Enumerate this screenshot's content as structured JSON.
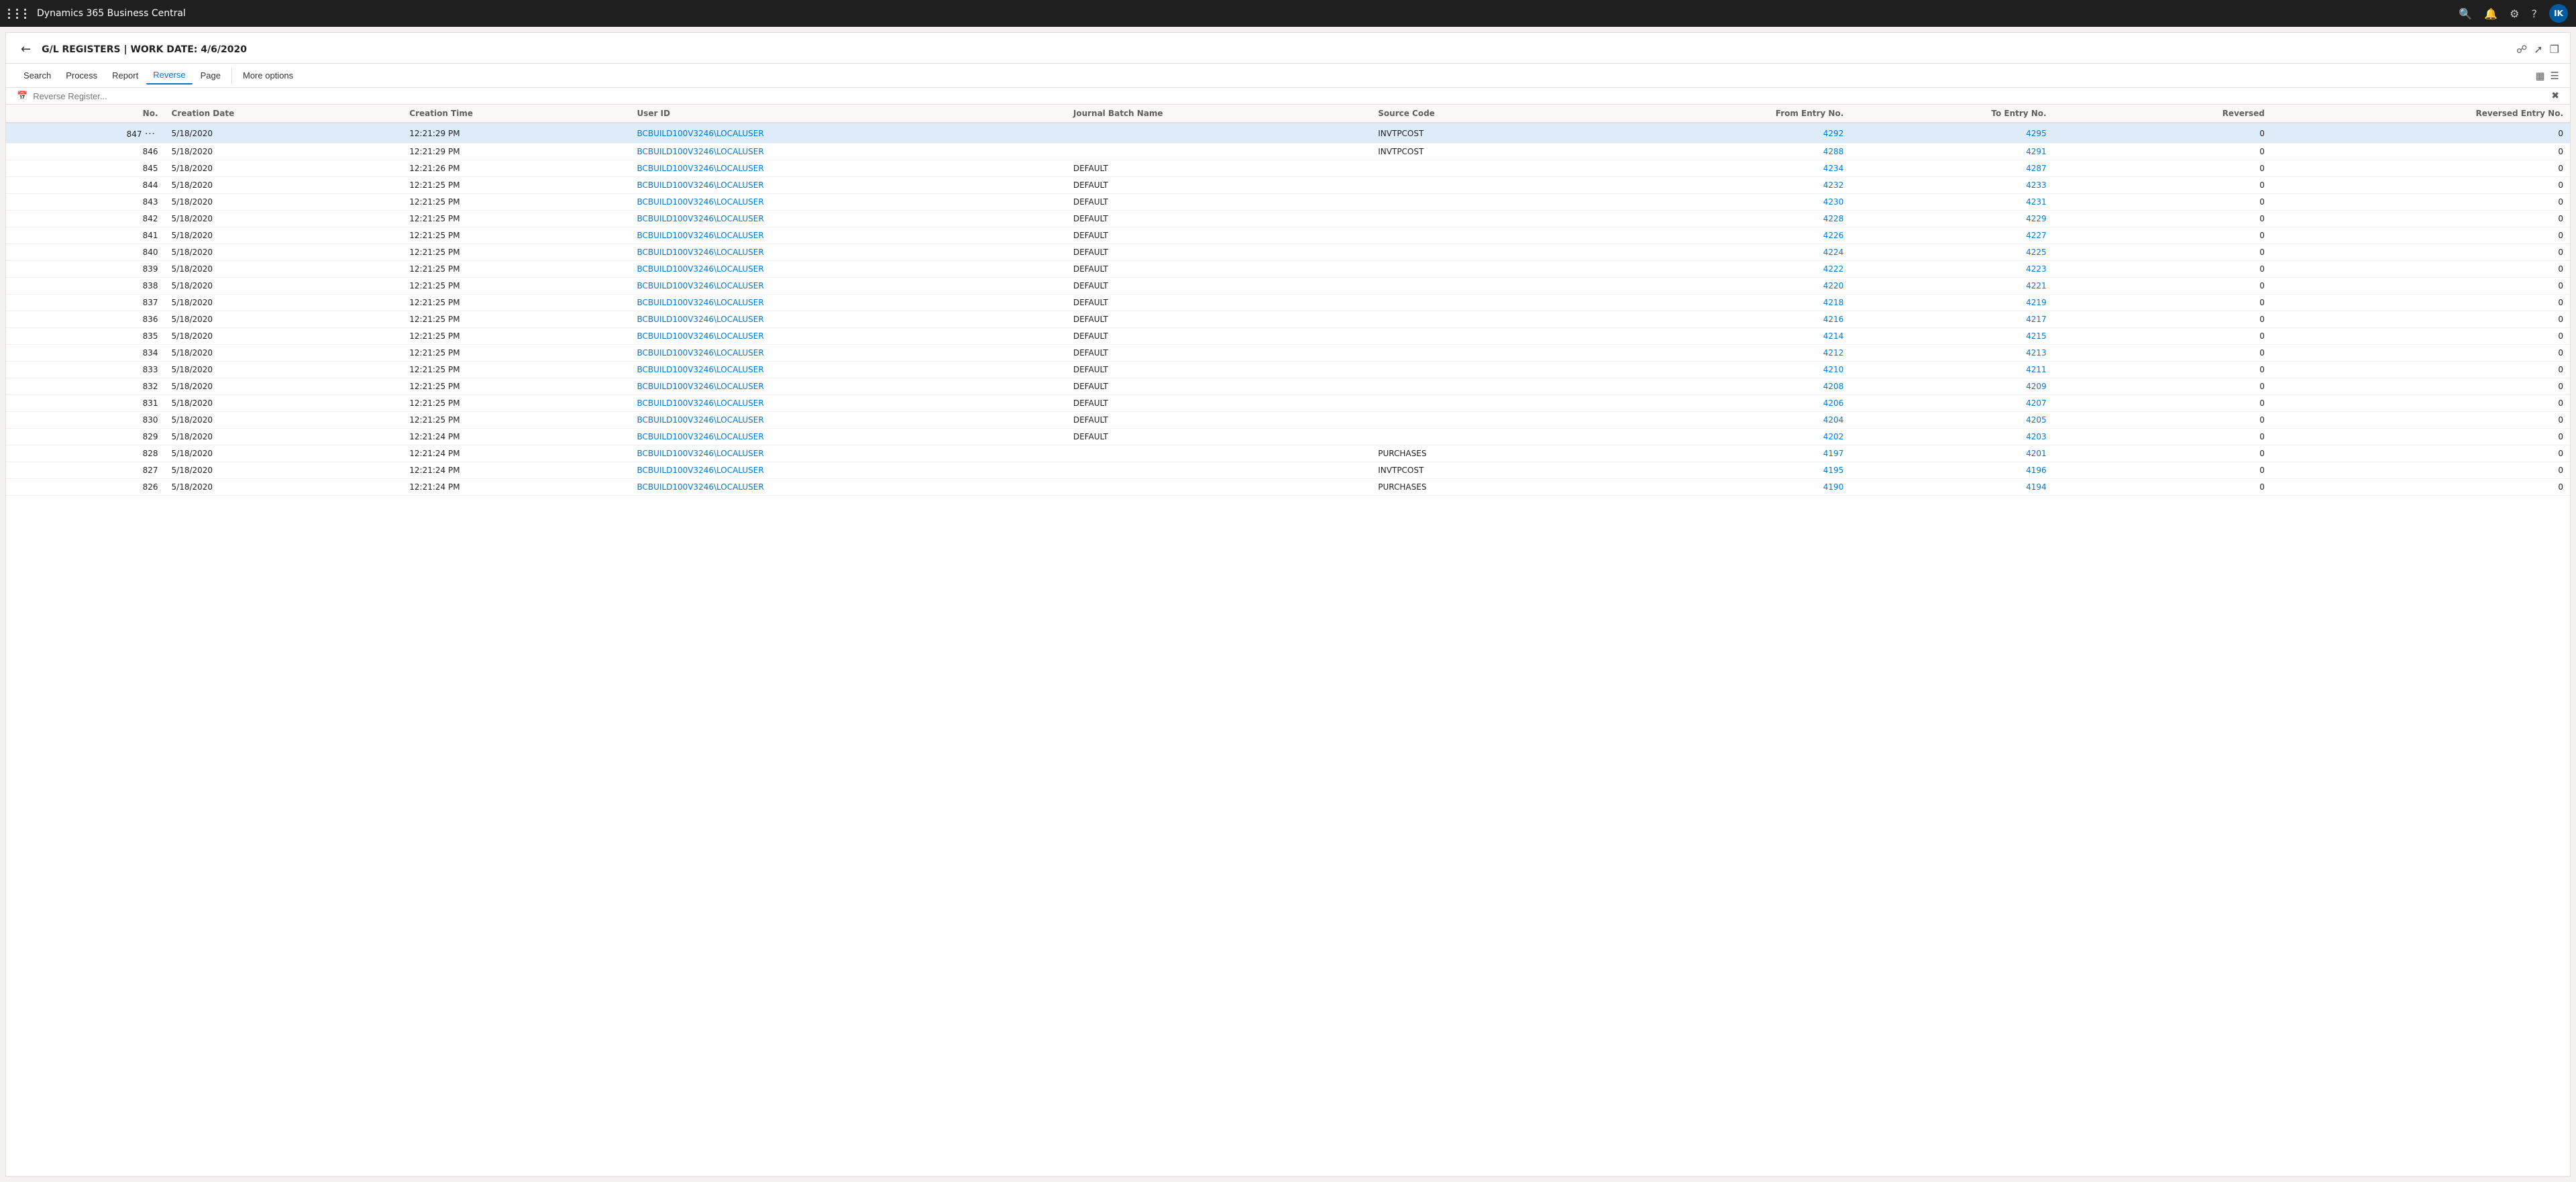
{
  "topbar": {
    "title": "Dynamics 365 Business Central",
    "avatar_label": "IK"
  },
  "header": {
    "back_label": "←",
    "title": "G/L REGISTERS | WORK DATE: 4/6/2020"
  },
  "toolbar": {
    "search_label": "Search",
    "process_label": "Process",
    "report_label": "Report",
    "reverse_label": "Reverse",
    "page_label": "Page",
    "more_options_label": "More options"
  },
  "filter_bar": {
    "placeholder": "Reverse Register..."
  },
  "columns": [
    "No.",
    "Creation Date",
    "Creation Time",
    "User ID",
    "Journal Batch Name",
    "Source Code",
    "From Entry No.",
    "To Entry No.",
    "Reversed",
    "Reversed Entry No."
  ],
  "rows": [
    {
      "no": "847",
      "date": "5/18/2020",
      "time": "12:21:29 PM",
      "user": "BCBUILD100V3246\\LOCALUSER",
      "batch": "",
      "source": "INVTPCOST",
      "from": "4292",
      "to": "4295",
      "reversed": "0",
      "rev_no": "0",
      "selected": true
    },
    {
      "no": "846",
      "date": "5/18/2020",
      "time": "12:21:29 PM",
      "user": "BCBUILD100V3246\\LOCALUSER",
      "batch": "",
      "source": "INVTPCOST",
      "from": "4288",
      "to": "4291",
      "reversed": "0",
      "rev_no": "0"
    },
    {
      "no": "845",
      "date": "5/18/2020",
      "time": "12:21:26 PM",
      "user": "BCBUILD100V3246\\LOCALUSER",
      "batch": "DEFAULT",
      "source": "",
      "from": "4234",
      "to": "4287",
      "reversed": "0",
      "rev_no": "0"
    },
    {
      "no": "844",
      "date": "5/18/2020",
      "time": "12:21:25 PM",
      "user": "BCBUILD100V3246\\LOCALUSER",
      "batch": "DEFAULT",
      "source": "",
      "from": "4232",
      "to": "4233",
      "reversed": "0",
      "rev_no": "0"
    },
    {
      "no": "843",
      "date": "5/18/2020",
      "time": "12:21:25 PM",
      "user": "BCBUILD100V3246\\LOCALUSER",
      "batch": "DEFAULT",
      "source": "",
      "from": "4230",
      "to": "4231",
      "reversed": "0",
      "rev_no": "0"
    },
    {
      "no": "842",
      "date": "5/18/2020",
      "time": "12:21:25 PM",
      "user": "BCBUILD100V3246\\LOCALUSER",
      "batch": "DEFAULT",
      "source": "",
      "from": "4228",
      "to": "4229",
      "reversed": "0",
      "rev_no": "0"
    },
    {
      "no": "841",
      "date": "5/18/2020",
      "time": "12:21:25 PM",
      "user": "BCBUILD100V3246\\LOCALUSER",
      "batch": "DEFAULT",
      "source": "",
      "from": "4226",
      "to": "4227",
      "reversed": "0",
      "rev_no": "0"
    },
    {
      "no": "840",
      "date": "5/18/2020",
      "time": "12:21:25 PM",
      "user": "BCBUILD100V3246\\LOCALUSER",
      "batch": "DEFAULT",
      "source": "",
      "from": "4224",
      "to": "4225",
      "reversed": "0",
      "rev_no": "0"
    },
    {
      "no": "839",
      "date": "5/18/2020",
      "time": "12:21:25 PM",
      "user": "BCBUILD100V3246\\LOCALUSER",
      "batch": "DEFAULT",
      "source": "",
      "from": "4222",
      "to": "4223",
      "reversed": "0",
      "rev_no": "0"
    },
    {
      "no": "838",
      "date": "5/18/2020",
      "time": "12:21:25 PM",
      "user": "BCBUILD100V3246\\LOCALUSER",
      "batch": "DEFAULT",
      "source": "",
      "from": "4220",
      "to": "4221",
      "reversed": "0",
      "rev_no": "0"
    },
    {
      "no": "837",
      "date": "5/18/2020",
      "time": "12:21:25 PM",
      "user": "BCBUILD100V3246\\LOCALUSER",
      "batch": "DEFAULT",
      "source": "",
      "from": "4218",
      "to": "4219",
      "reversed": "0",
      "rev_no": "0"
    },
    {
      "no": "836",
      "date": "5/18/2020",
      "time": "12:21:25 PM",
      "user": "BCBUILD100V3246\\LOCALUSER",
      "batch": "DEFAULT",
      "source": "",
      "from": "4216",
      "to": "4217",
      "reversed": "0",
      "rev_no": "0"
    },
    {
      "no": "835",
      "date": "5/18/2020",
      "time": "12:21:25 PM",
      "user": "BCBUILD100V3246\\LOCALUSER",
      "batch": "DEFAULT",
      "source": "",
      "from": "4214",
      "to": "4215",
      "reversed": "0",
      "rev_no": "0"
    },
    {
      "no": "834",
      "date": "5/18/2020",
      "time": "12:21:25 PM",
      "user": "BCBUILD100V3246\\LOCALUSER",
      "batch": "DEFAULT",
      "source": "",
      "from": "4212",
      "to": "4213",
      "reversed": "0",
      "rev_no": "0"
    },
    {
      "no": "833",
      "date": "5/18/2020",
      "time": "12:21:25 PM",
      "user": "BCBUILD100V3246\\LOCALUSER",
      "batch": "DEFAULT",
      "source": "",
      "from": "4210",
      "to": "4211",
      "reversed": "0",
      "rev_no": "0"
    },
    {
      "no": "832",
      "date": "5/18/2020",
      "time": "12:21:25 PM",
      "user": "BCBUILD100V3246\\LOCALUSER",
      "batch": "DEFAULT",
      "source": "",
      "from": "4208",
      "to": "4209",
      "reversed": "0",
      "rev_no": "0"
    },
    {
      "no": "831",
      "date": "5/18/2020",
      "time": "12:21:25 PM",
      "user": "BCBUILD100V3246\\LOCALUSER",
      "batch": "DEFAULT",
      "source": "",
      "from": "4206",
      "to": "4207",
      "reversed": "0",
      "rev_no": "0"
    },
    {
      "no": "830",
      "date": "5/18/2020",
      "time": "12:21:25 PM",
      "user": "BCBUILD100V3246\\LOCALUSER",
      "batch": "DEFAULT",
      "source": "",
      "from": "4204",
      "to": "4205",
      "reversed": "0",
      "rev_no": "0"
    },
    {
      "no": "829",
      "date": "5/18/2020",
      "time": "12:21:24 PM",
      "user": "BCBUILD100V3246\\LOCALUSER",
      "batch": "DEFAULT",
      "source": "",
      "from": "4202",
      "to": "4203",
      "reversed": "0",
      "rev_no": "0"
    },
    {
      "no": "828",
      "date": "5/18/2020",
      "time": "12:21:24 PM",
      "user": "BCBUILD100V3246\\LOCALUSER",
      "batch": "",
      "source": "PURCHASES",
      "from": "4197",
      "to": "4201",
      "reversed": "0",
      "rev_no": "0"
    },
    {
      "no": "827",
      "date": "5/18/2020",
      "time": "12:21:24 PM",
      "user": "BCBUILD100V3246\\LOCALUSER",
      "batch": "",
      "source": "INVTPCOST",
      "from": "4195",
      "to": "4196",
      "reversed": "0",
      "rev_no": "0"
    },
    {
      "no": "826",
      "date": "5/18/2020",
      "time": "12:21:24 PM",
      "user": "BCBUILD100V3246\\LOCALUSER",
      "batch": "",
      "source": "PURCHASES",
      "from": "4190",
      "to": "4194",
      "reversed": "0",
      "rev_no": "0"
    }
  ]
}
